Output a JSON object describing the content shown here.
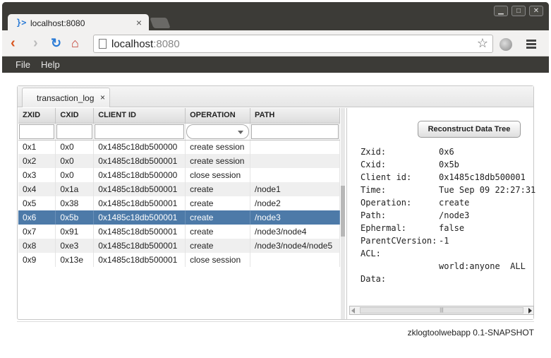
{
  "browser": {
    "tab_title": "localhost:8080",
    "tab_icon": "terminal-prompt-icon",
    "url_host": "localhost",
    "url_port": ":8080",
    "window_buttons": [
      "minimize",
      "maximize",
      "close"
    ]
  },
  "menubar": {
    "file": "File",
    "help": "Help"
  },
  "panel": {
    "tab_label": "transaction_log",
    "tab_close": "×"
  },
  "table": {
    "columns": [
      "ZXID",
      "CXID",
      "CLIENT ID",
      "OPERATION",
      "PATH"
    ],
    "rows": [
      {
        "zxid": "0x1",
        "cxid": "0x0",
        "client": "0x1485c18db500000",
        "op": "create session",
        "path": ""
      },
      {
        "zxid": "0x2",
        "cxid": "0x0",
        "client": "0x1485c18db500001",
        "op": "create session",
        "path": ""
      },
      {
        "zxid": "0x3",
        "cxid": "0x0",
        "client": "0x1485c18db500000",
        "op": "close session",
        "path": ""
      },
      {
        "zxid": "0x4",
        "cxid": "0x1a",
        "client": "0x1485c18db500001",
        "op": "create",
        "path": "/node1"
      },
      {
        "zxid": "0x5",
        "cxid": "0x38",
        "client": "0x1485c18db500001",
        "op": "create",
        "path": "/node2"
      },
      {
        "zxid": "0x6",
        "cxid": "0x5b",
        "client": "0x1485c18db500001",
        "op": "create",
        "path": "/node3"
      },
      {
        "zxid": "0x7",
        "cxid": "0x91",
        "client": "0x1485c18db500001",
        "op": "create",
        "path": "/node3/node4"
      },
      {
        "zxid": "0x8",
        "cxid": "0xe3",
        "client": "0x1485c18db500001",
        "op": "create",
        "path": "/node3/node4/node5"
      },
      {
        "zxid": "0x9",
        "cxid": "0x13e",
        "client": "0x1485c18db500001",
        "op": "close session",
        "path": ""
      }
    ],
    "selected_zxid": "0x6"
  },
  "detail": {
    "reconstruct_button": "Reconstruct Data Tree",
    "fields": [
      {
        "key": "Zxid:",
        "value": "0x6"
      },
      {
        "key": "Cxid:",
        "value": "0x5b"
      },
      {
        "key": "Client id:",
        "value": "0x1485c18db500001"
      },
      {
        "key": "Time:",
        "value": "Tue Sep 09 22:27:31"
      },
      {
        "key": "Operation:",
        "value": "create"
      },
      {
        "key": "Path:",
        "value": "/node3"
      },
      {
        "key": "Ephermal:",
        "value": "false"
      },
      {
        "key": "ParentCVersion:",
        "value": "-1"
      },
      {
        "key": "ACL:",
        "value": ""
      },
      {
        "key": "",
        "value": "world:anyone  ALL"
      },
      {
        "key": "Data:",
        "value": ""
      }
    ]
  },
  "footer": {
    "version": "zklogtoolwebapp 0.1-SNAPSHOT"
  },
  "colors": {
    "selection": "#4d7aa8",
    "menubar": "#3c3b37",
    "accent": "#2a7bd6"
  }
}
